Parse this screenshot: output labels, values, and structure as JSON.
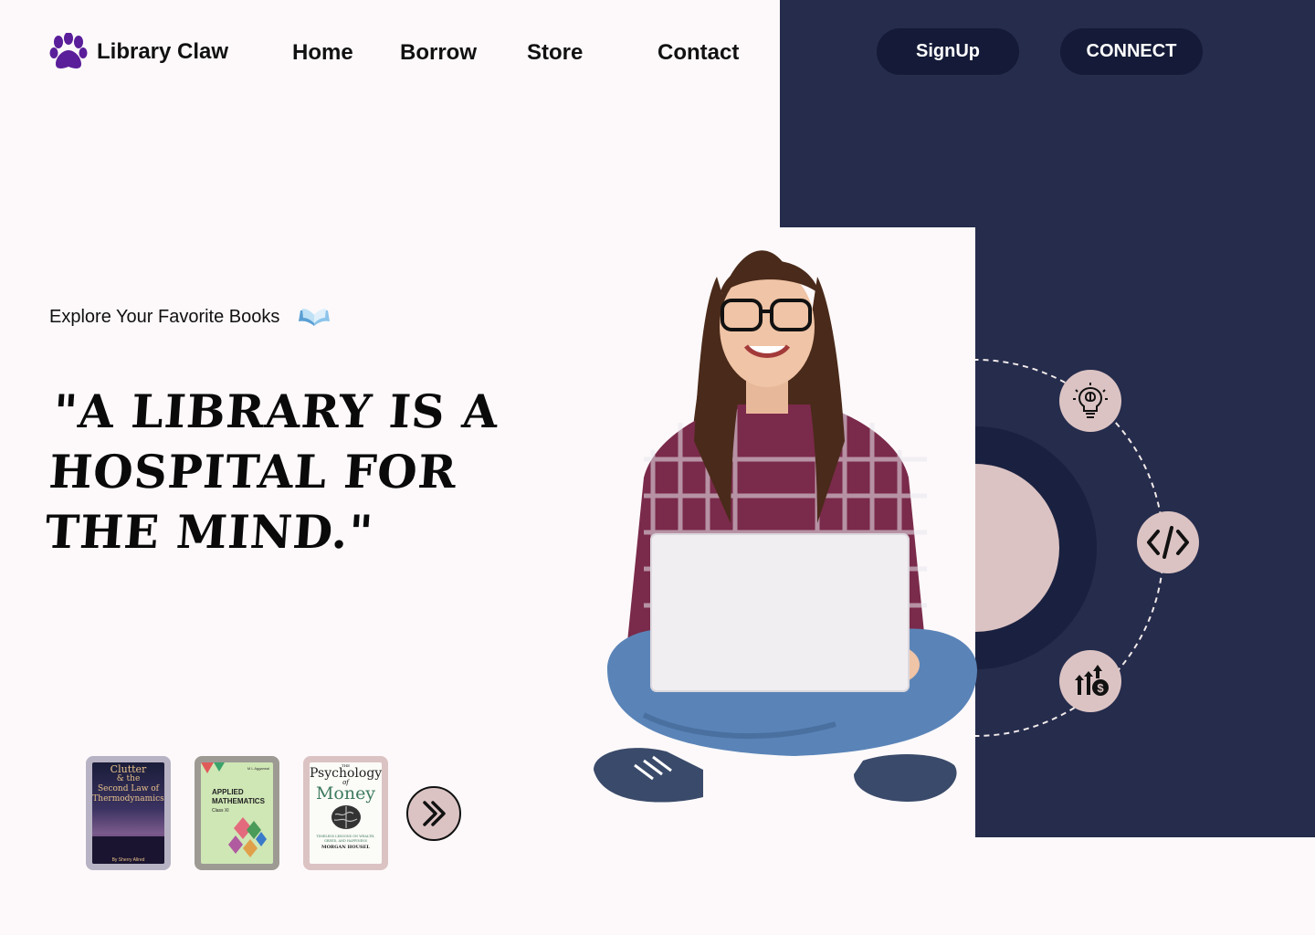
{
  "brand": {
    "name": "Library Claw",
    "icon": "paw-icon",
    "icon_color": "#5a1e9a"
  },
  "nav": {
    "home": "Home",
    "borrow": "Borrow",
    "store": "Store",
    "contact": "Contact"
  },
  "actions": {
    "signup": "SignUp",
    "connect": "CONNECT"
  },
  "hero": {
    "tagline": "Explore Your Favorite Books",
    "tagline_icon": "open-book-icon",
    "quote": "\"A library is a hospital for the mind.\""
  },
  "books": [
    {
      "title_line1": "Clutter",
      "title_line2": "& the",
      "title_line3": "Second Law of",
      "title_line4": "Thermodynamics",
      "author": "By Sherry Allred"
    },
    {
      "title": "APPLIED MATHEMATICS",
      "subtitle": "Class XI",
      "author": "M L Aggarwal"
    },
    {
      "title_the": "THE",
      "title_word1": "Psychology",
      "title_of": "of",
      "title_word2": "Money",
      "subtitle": "TIMELESS LESSONS ON WEALTH, GREED, AND HAPPINESS",
      "author": "MORGAN HOUSEL"
    }
  ],
  "carousel": {
    "next_icon": "double-chevron-right-icon"
  },
  "orbit": {
    "icons": [
      "brain-bulb-icon",
      "code-icon",
      "growth-dollar-icon"
    ]
  },
  "colors": {
    "navy": "#252c4c",
    "navy_dark": "#141a37",
    "pink": "#dcc3c3",
    "background": "#fdf9fa"
  }
}
